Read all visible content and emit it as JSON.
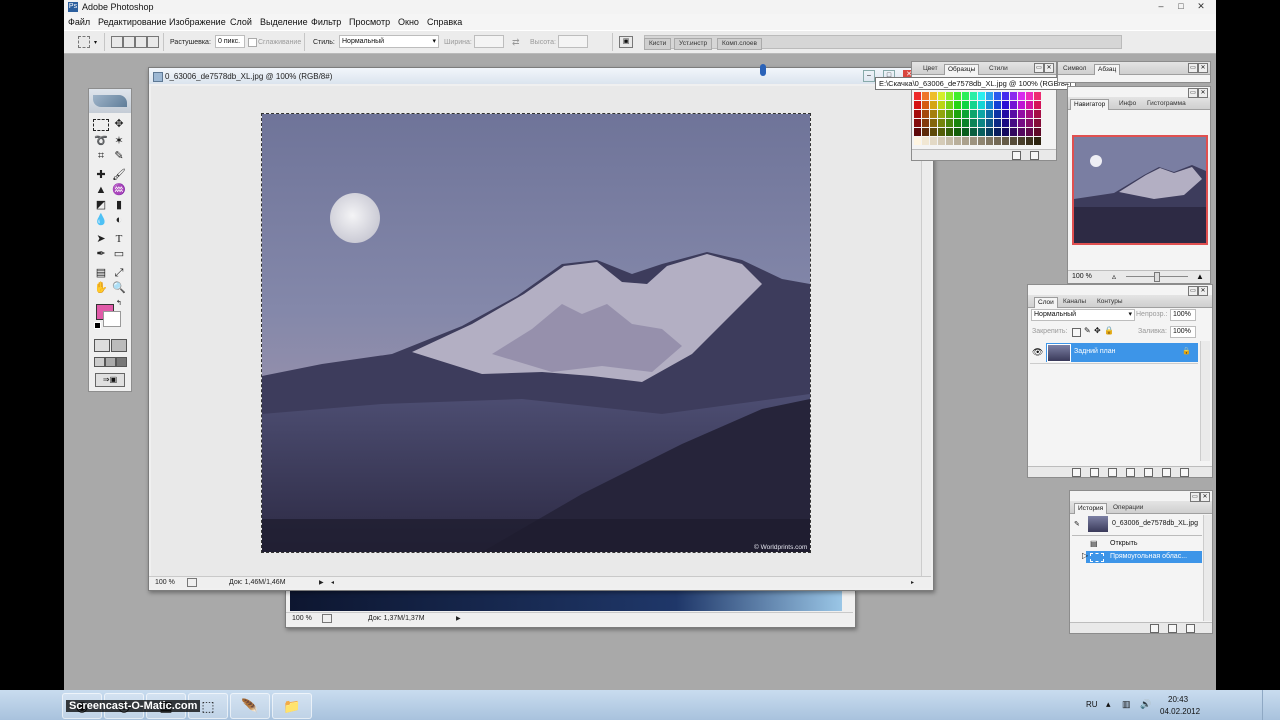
{
  "app": {
    "title": "Adobe Photoshop",
    "menu": [
      "Файл",
      "Редактирование",
      "Изображение",
      "Слой",
      "Выделение",
      "Фильтр",
      "Просмотр",
      "Окно",
      "Справка"
    ]
  },
  "options": {
    "feather_label": "Растушевка:",
    "feather_value": "0 пикс.",
    "antialias_label": "Сглаживание",
    "style_label": "Стиль:",
    "style_value": "Нормальный",
    "width_label": "Ширина:",
    "height_label": "Высота:",
    "well_tabs": [
      "Кисти",
      "Уст.инстр",
      "Комп.слоев"
    ]
  },
  "colors": {
    "foreground": "#e05aa8",
    "background": "#ffffff",
    "selection": "#3d95e8"
  },
  "doc_front": {
    "title": "0_63006_de7578db_XL.jpg @ 100% (RGB/8#)",
    "zoom": "100 %",
    "doc_info": "Док: 1,46M/1,46M",
    "watermark": "© Worldprints.com"
  },
  "doc_back": {
    "zoom": "100 %",
    "doc_info": "Док: 1,37M/1,37M"
  },
  "tooltip": "E:\\Скачка\\0_63006_de7578db_XL.jpg @ 100% (RGB/8#)",
  "swatches_panel": {
    "tabs": [
      "Цвет",
      "Образцы",
      "Стили"
    ]
  },
  "top_right_tabs": [
    "Символ",
    "Абзац"
  ],
  "navigator_panel": {
    "tabs": [
      "Навигатор",
      "Инфо",
      "Гистограмма"
    ],
    "zoom": "100 %"
  },
  "layers_panel": {
    "tabs": [
      "Слои",
      "Каналы",
      "Контуры"
    ],
    "blend_mode": "Нормальный",
    "opacity_label": "Непрозр.:",
    "opacity_value": "100%",
    "lock_label": "Закрепить:",
    "fill_label": "Заливка:",
    "fill_value": "100%",
    "layer_name": "Задний план"
  },
  "history_panel": {
    "tabs": [
      "История",
      "Операции"
    ],
    "snapshot": "0_63006_de7578db_XL.jpg",
    "items": [
      "Открыть",
      "Прямоугольная облас..."
    ]
  },
  "taskbar": {
    "watermark": "Screencast-O-Matic.com",
    "lang": "RU",
    "time": "20:43",
    "date": "04.02.2012"
  }
}
